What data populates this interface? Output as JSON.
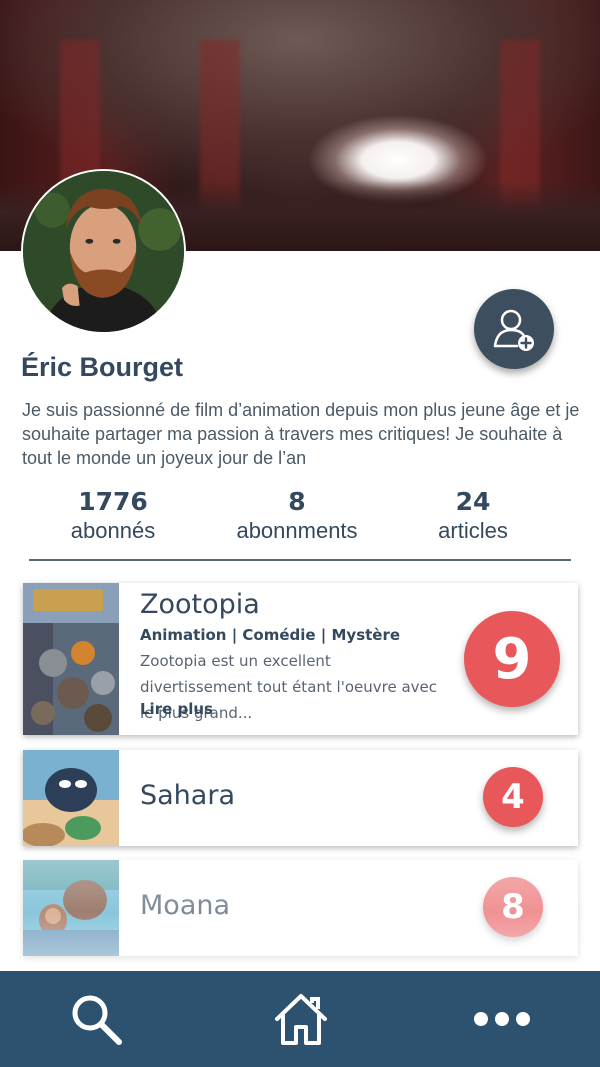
{
  "profile": {
    "name": "Éric Bourget",
    "bio": "Je suis passionné de film d’animation depuis mon plus jeune âge et je souhaite partager ma passion à travers mes critiques! Je souhaite à tout le monde un joyeux jour de l’an",
    "follow_icon": "add-user-icon"
  },
  "stats": [
    {
      "value": "1776",
      "label": "abonnés"
    },
    {
      "value": "8",
      "label": "abonnments"
    },
    {
      "value": "24",
      "label": "articles"
    }
  ],
  "reviews": [
    {
      "title": "Zootopia",
      "genres": "Animation | Comédie | Mystère",
      "description": "Zootopia est un excellent divertissement tout étant l'oeuvre avec le plus grand...",
      "more_label": "Lire plus",
      "score": "9"
    },
    {
      "title": "Sahara",
      "score": "4"
    },
    {
      "title": "Moana",
      "score": "8"
    }
  ],
  "nav": {
    "items": [
      "search-icon",
      "home-icon",
      "more-icon"
    ]
  },
  "colors": {
    "primary": "#34495e",
    "score": "#e8575a",
    "nav": "#2c5270"
  }
}
